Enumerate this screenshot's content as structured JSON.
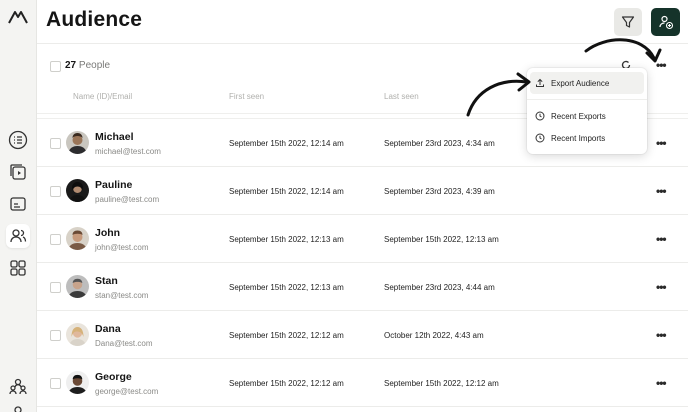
{
  "header": {
    "title": "Audience"
  },
  "toolbar": {
    "filter_icon": "filter-icon",
    "add_icon": "add-user-icon",
    "add_color": "#15332a"
  },
  "list": {
    "count": "27",
    "count_suffix": "People",
    "columns": {
      "name": "Name (ID)/Email",
      "first_seen": "First seen",
      "last_seen": "Last seen"
    }
  },
  "rows": [
    {
      "name": "Michael",
      "email": "michael@test.com",
      "first_seen": "September 15th 2022, 12:14 am",
      "last_seen": "September 23rd 2023, 4:34 am"
    },
    {
      "name": "Pauline",
      "email": "pauline@test.com",
      "first_seen": "September 15th 2022, 12:14 am",
      "last_seen": "September 23rd 2023, 4:39 am"
    },
    {
      "name": "John",
      "email": "john@test.com",
      "first_seen": "September 15th 2022, 12:13 am",
      "last_seen": "September 15th 2022, 12:13 am"
    },
    {
      "name": "Stan",
      "email": "stan@test.com",
      "first_seen": "September 15th 2022, 12:13 am",
      "last_seen": "September 23rd 2023, 4:44 am"
    },
    {
      "name": "Dana",
      "email": "Dana@test.com",
      "first_seen": "September 15th 2022, 12:12 am",
      "last_seen": "October 12th 2022, 4:43 am"
    },
    {
      "name": "George",
      "email": "george@test.com",
      "first_seen": "September 15th 2022, 12:12 am",
      "last_seen": "September 15th 2022, 12:12 am"
    }
  ],
  "more_label": "•••",
  "menu": {
    "items": [
      {
        "label": "Export Audience",
        "icon": "upload-icon"
      },
      {
        "label": "Recent Exports",
        "icon": "clock-icon"
      },
      {
        "label": "Recent Imports",
        "icon": "clock-icon"
      }
    ]
  }
}
